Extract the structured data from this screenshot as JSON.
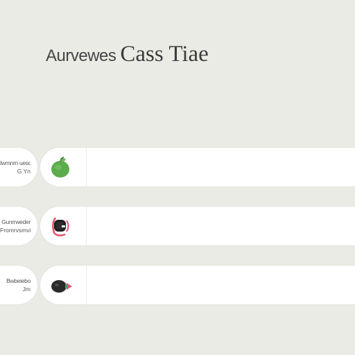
{
  "header": {
    "title_part1": "Aurvewes",
    "title_part2": "Cass Tiae"
  },
  "rows": [
    {
      "label_line1": "Iwmnm uesdle",
      "label_line2": "G Yn",
      "icon": "green-apple-icon",
      "icon_color": "#5cab4c"
    },
    {
      "label_line1": "Gunrrweder",
      "label_line2": "Fromrvsmvi",
      "icon": "smartwatch-icon",
      "icon_color": "#e4506a"
    },
    {
      "label_line1": "Bwbeiebo",
      "label_line2": "Jm",
      "icon": "camera-icon",
      "icon_color": "#e84f74"
    }
  ]
}
